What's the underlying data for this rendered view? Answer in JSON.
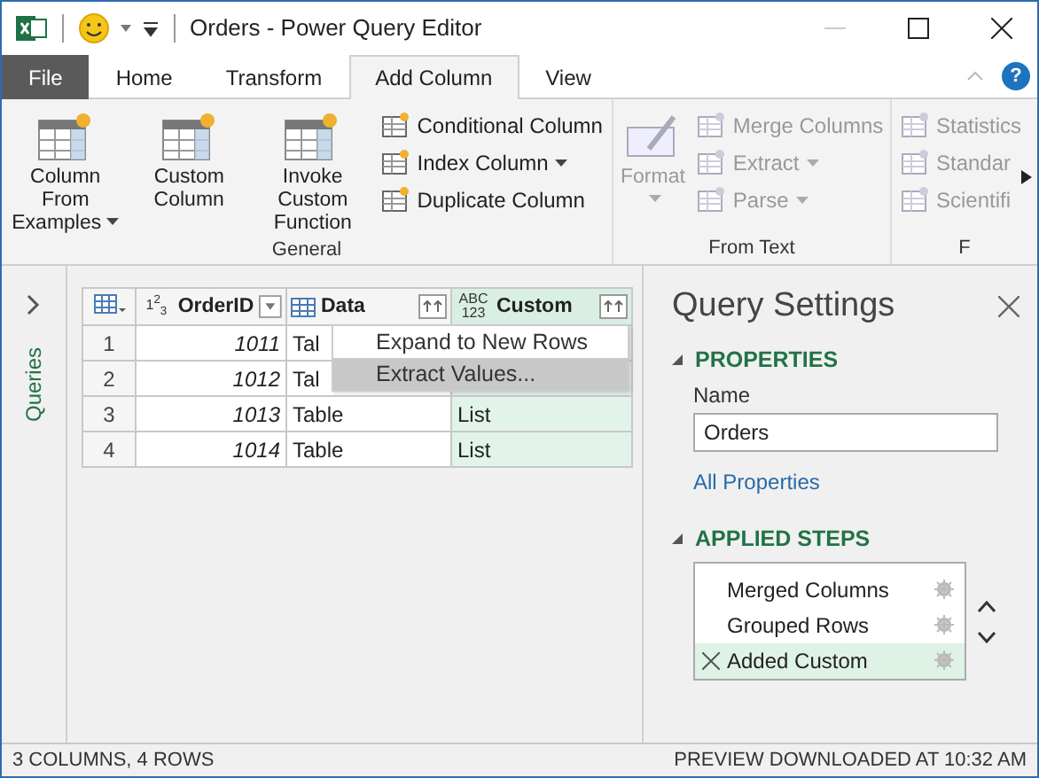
{
  "window": {
    "title": "Orders - Power Query Editor",
    "help": "?"
  },
  "tabs": [
    {
      "label": "File",
      "kind": "file",
      "selected": false
    },
    {
      "label": "Home",
      "kind": "tab",
      "selected": false
    },
    {
      "label": "Transform",
      "kind": "tab",
      "selected": false
    },
    {
      "label": "Add Column",
      "kind": "tab",
      "selected": true
    },
    {
      "label": "View",
      "kind": "tab",
      "selected": false
    }
  ],
  "ribbon": {
    "groups": [
      {
        "label": "General",
        "large": [
          {
            "label": "Column From Examples",
            "dropdown": true,
            "disabled": false
          },
          {
            "label": "Custom Column",
            "dropdown": false,
            "disabled": false
          },
          {
            "label": "Invoke Custom Function",
            "dropdown": false,
            "disabled": false
          }
        ],
        "small": [
          {
            "label": "Conditional Column",
            "dropdown": false,
            "disabled": false
          },
          {
            "label": "Index Column",
            "dropdown": true,
            "disabled": false
          },
          {
            "label": "Duplicate Column",
            "dropdown": false,
            "disabled": false
          }
        ]
      },
      {
        "label": "From Text",
        "large": [
          {
            "label": "Format",
            "dropdown": true,
            "disabled": true
          }
        ],
        "small": [
          {
            "label": "Merge Columns",
            "dropdown": false,
            "disabled": true
          },
          {
            "label": "Extract",
            "dropdown": true,
            "disabled": true
          },
          {
            "label": "Parse",
            "dropdown": true,
            "disabled": true
          }
        ]
      },
      {
        "label": "F",
        "small": [
          {
            "label": "Statistics",
            "dropdown": false,
            "disabled": true
          },
          {
            "label": "Standar",
            "dropdown": false,
            "disabled": true
          },
          {
            "label": "Scientifi",
            "dropdown": false,
            "disabled": true
          }
        ]
      }
    ]
  },
  "queries_pane": {
    "label": "Queries"
  },
  "grid": {
    "columns": [
      {
        "name": "OrderID",
        "type_label": "1$^{2}$$_{3}$",
        "kind": "filter",
        "selected": false
      },
      {
        "name": "Data",
        "kind": "expand",
        "selected": false
      },
      {
        "name": "Custom",
        "type_label": "ABC 123",
        "kind": "expand",
        "selected": true
      }
    ],
    "rows": [
      {
        "num": "1",
        "order_id": "1011",
        "data": "Tal"
      },
      {
        "num": "2",
        "order_id": "1012",
        "data": "Tal"
      },
      {
        "num": "3",
        "order_id": "1013",
        "data": "Table",
        "custom": "List"
      },
      {
        "num": "4",
        "order_id": "1014",
        "data": "Table",
        "custom": "List"
      }
    ]
  },
  "context_menu": {
    "items": [
      {
        "label": "Expand to New Rows",
        "selected": false
      },
      {
        "label": "Extract Values...",
        "selected": true
      }
    ]
  },
  "query_settings": {
    "title": "Query Settings",
    "properties": {
      "heading": "PROPERTIES",
      "name_label": "Name",
      "name_value": "Orders",
      "link": "All Properties"
    },
    "applied_steps": {
      "heading": "APPLIED STEPS",
      "steps": [
        {
          "label": "Merged Columns",
          "selected": false
        },
        {
          "label": "Grouped Rows",
          "selected": false
        },
        {
          "label": "Added Custom",
          "selected": true
        }
      ]
    }
  },
  "status_bar": {
    "left": "3 COLUMNS, 4 ROWS",
    "right": "PREVIEW DOWNLOADED AT 10:32 AM"
  }
}
